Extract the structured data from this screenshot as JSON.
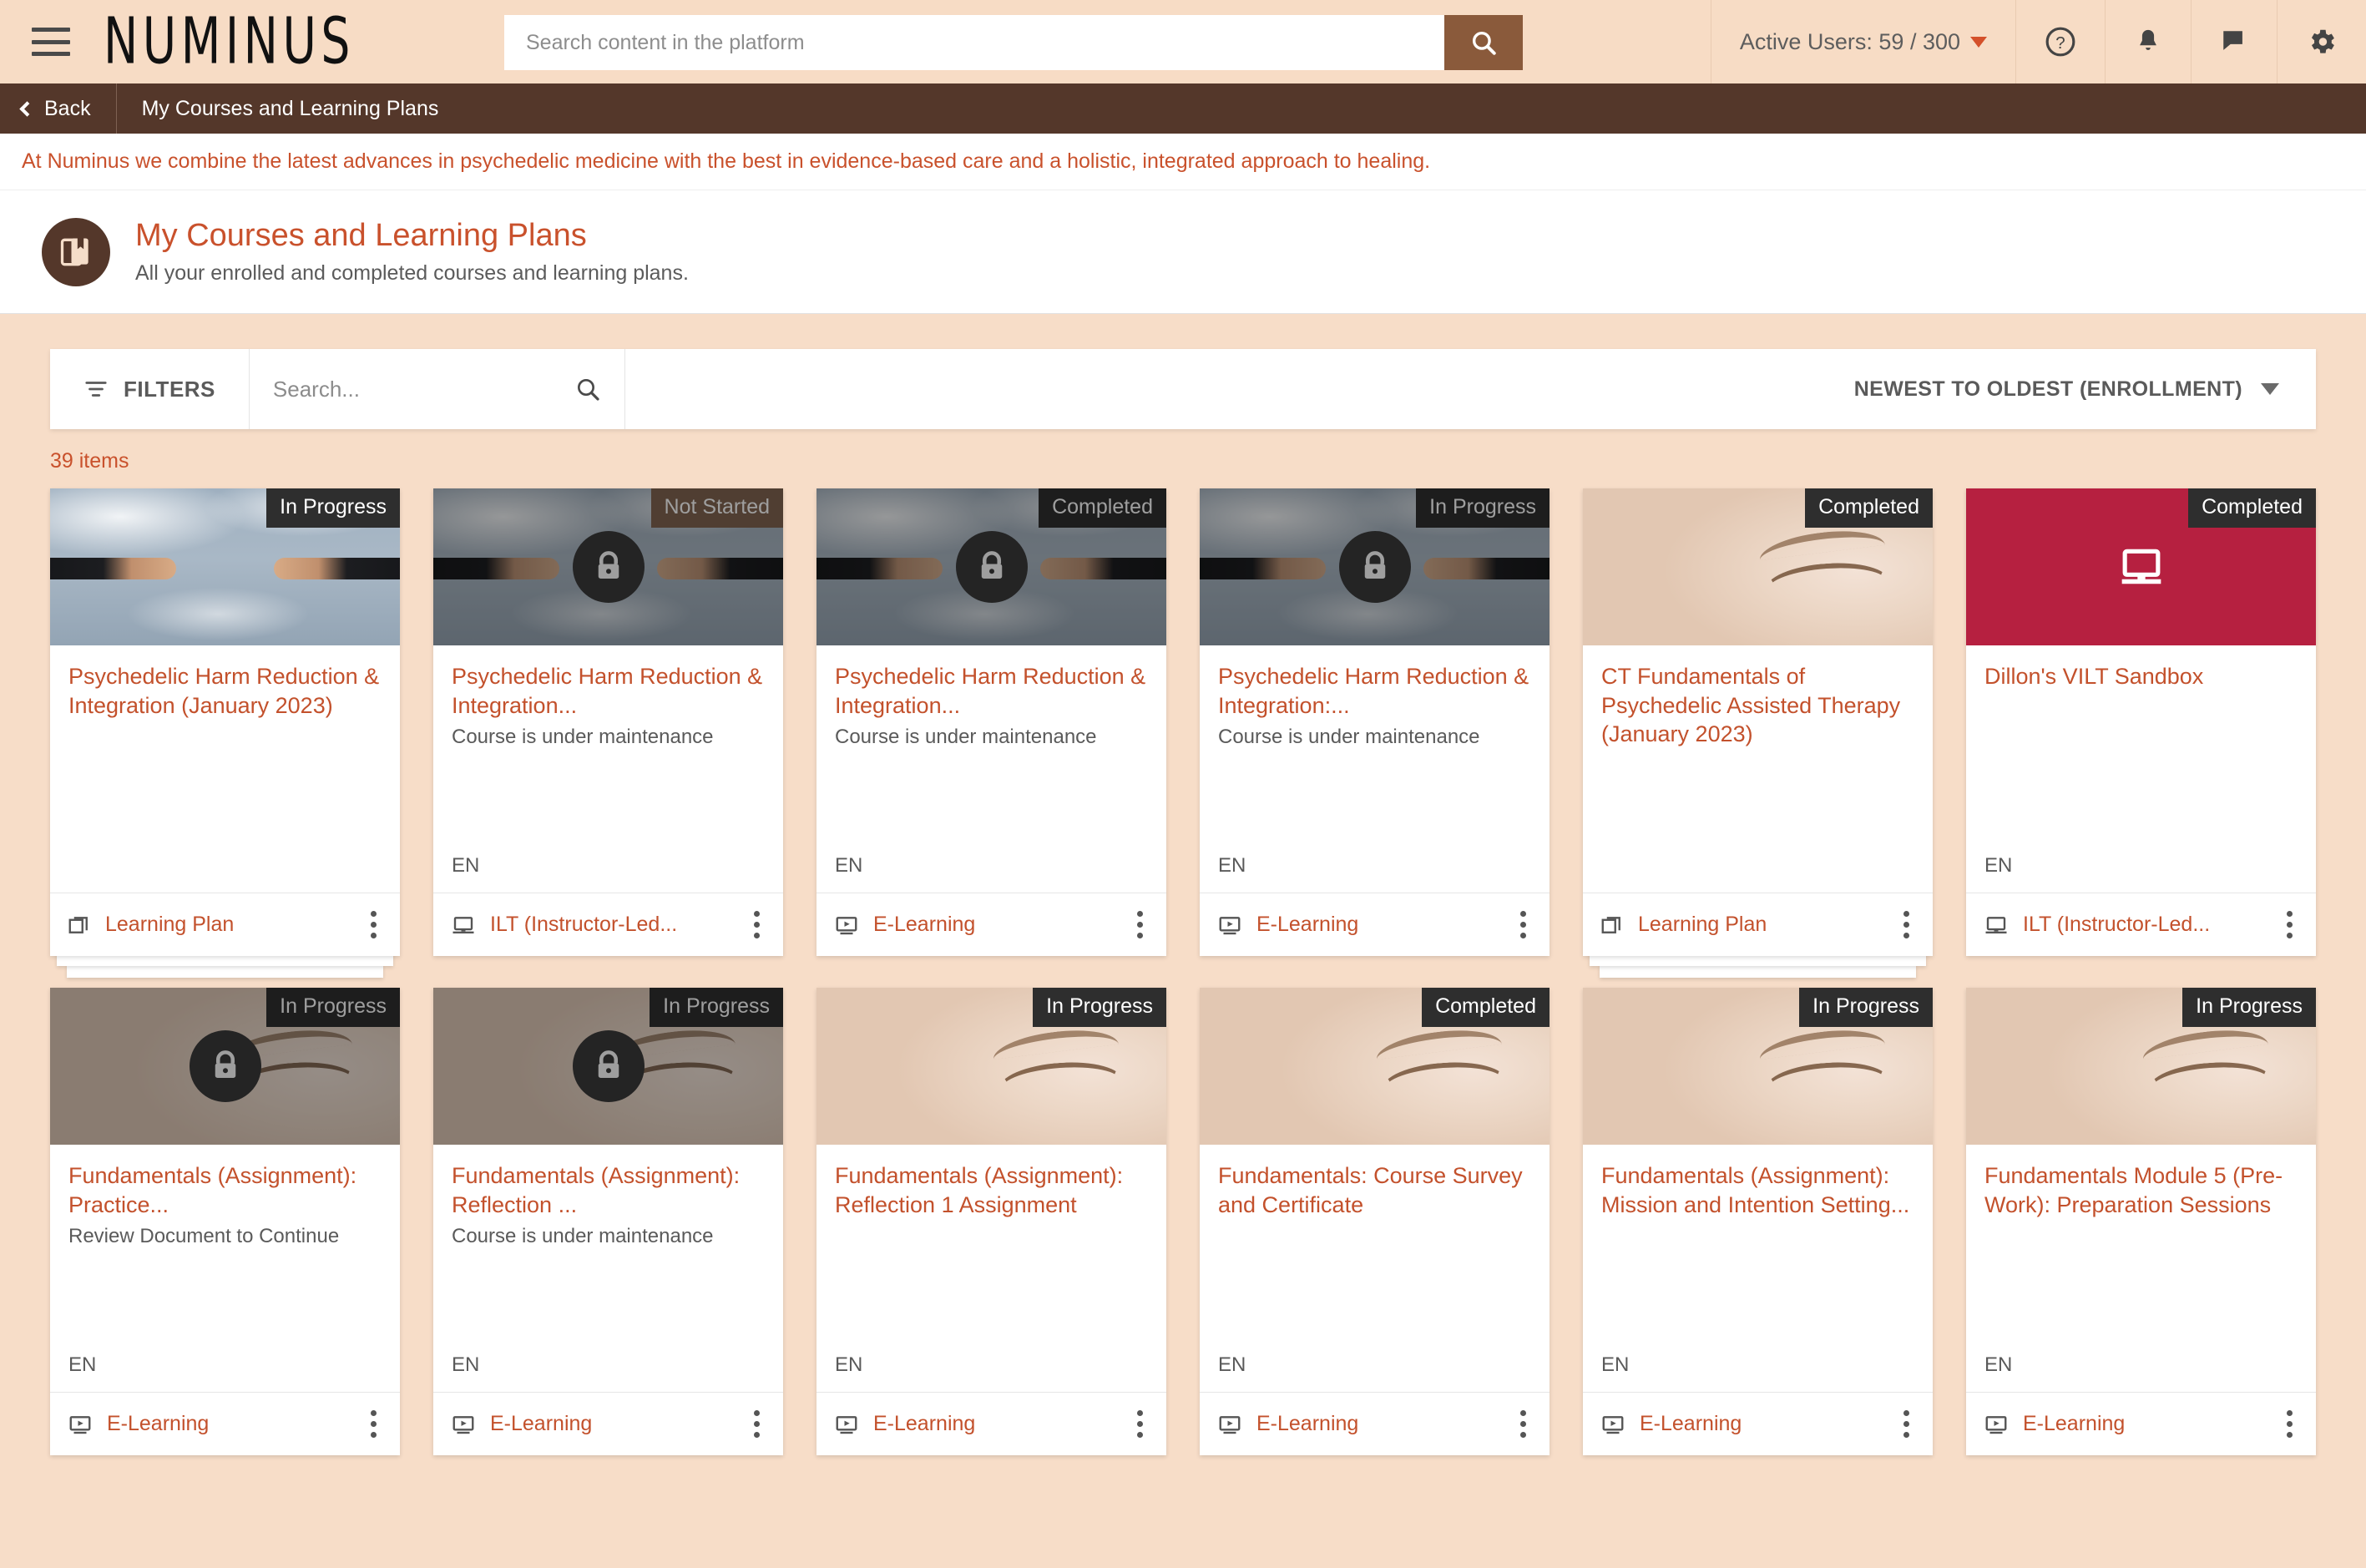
{
  "header": {
    "brand": "NUMINUS",
    "menu_icon": "hamburger-icon",
    "search_placeholder": "Search content in the platform",
    "search_value": "",
    "active_users": "Active Users: 59 / 300",
    "icons": [
      "help-icon",
      "bell-icon",
      "chat-icon",
      "gear-icon"
    ]
  },
  "breadcrumb": {
    "back_label": "Back",
    "title": "My Courses and Learning Plans"
  },
  "notice": {
    "text": "At Numinus we combine the latest advances in psychedelic medicine with the best in evidence-based care and a holistic, integrated approach to healing."
  },
  "page": {
    "title": "My Courses and Learning Plans",
    "subtitle": "All your enrolled and completed courses and learning plans."
  },
  "toolbar": {
    "filters_label": "FILTERS",
    "search_placeholder": "Search...",
    "search_value": "",
    "sort_label": "NEWEST TO OLDEST (ENROLLMENT)",
    "item_count": "39 items"
  },
  "colors": {
    "page_bg": "#f7ddc8",
    "brand_brown": "#54372a",
    "accent_orange": "#c3512c",
    "badge_dark": "#2e2e2e",
    "badge_brown": "#86634d",
    "tile_red": "#b62040"
  },
  "cards": [
    {
      "status": "In Progress",
      "status_style": "dark",
      "title": "Psychedelic Harm Reduction & Integration (January 2023)",
      "subtitle": "",
      "language": "",
      "type_label": "Learning Plan",
      "type_icon": "layers-icon",
      "thumb": "hands",
      "locked": false,
      "stacked": true
    },
    {
      "status": "Not Started",
      "status_style": "brown",
      "title": "Psychedelic Harm Reduction & Integration...",
      "subtitle": "Course is under maintenance",
      "language": "EN",
      "type_label": "ILT (Instructor-Led...",
      "type_icon": "classroom-icon",
      "thumb": "hands",
      "locked": true,
      "stacked": false
    },
    {
      "status": "Completed",
      "status_style": "dark",
      "title": "Psychedelic Harm Reduction & Integration...",
      "subtitle": "Course is under maintenance",
      "language": "EN",
      "type_label": "E-Learning",
      "type_icon": "elearning-icon",
      "thumb": "hands",
      "locked": true,
      "stacked": false
    },
    {
      "status": "In Progress",
      "status_style": "dark",
      "title": "Psychedelic Harm Reduction & Integration:...",
      "subtitle": "Course is under maintenance",
      "language": "EN",
      "type_label": "E-Learning",
      "type_icon": "elearning-icon",
      "thumb": "hands",
      "locked": true,
      "stacked": false
    },
    {
      "status": "Completed",
      "status_style": "dark",
      "title": "CT Fundamentals of Psychedelic Assisted Therapy (January 2023)",
      "subtitle": "",
      "language": "",
      "type_label": "Learning Plan",
      "type_icon": "layers-icon",
      "thumb": "face",
      "locked": false,
      "stacked": true
    },
    {
      "status": "Completed",
      "status_style": "dark",
      "title": "Dillon's VILT Sandbox",
      "subtitle": "",
      "language": "EN",
      "type_label": "ILT (Instructor-Led...",
      "type_icon": "classroom-icon",
      "thumb": "flat-red",
      "locked": false,
      "stacked": false
    },
    {
      "status": "In Progress",
      "status_style": "dark",
      "title": "Fundamentals (Assignment): Practice...",
      "subtitle": "Review Document to Continue",
      "language": "EN",
      "type_label": "E-Learning",
      "type_icon": "elearning-icon",
      "thumb": "face",
      "locked": true,
      "stacked": false
    },
    {
      "status": "In Progress",
      "status_style": "dark",
      "title": "Fundamentals (Assignment): Reflection ...",
      "subtitle": "Course is under maintenance",
      "language": "EN",
      "type_label": "E-Learning",
      "type_icon": "elearning-icon",
      "thumb": "face",
      "locked": true,
      "stacked": false
    },
    {
      "status": "In Progress",
      "status_style": "dark",
      "title": "Fundamentals (Assignment): Reflection 1 Assignment",
      "subtitle": "",
      "language": "EN",
      "type_label": "E-Learning",
      "type_icon": "elearning-icon",
      "thumb": "face",
      "locked": false,
      "stacked": false
    },
    {
      "status": "Completed",
      "status_style": "dark",
      "title": "Fundamentals: Course Survey and Certificate",
      "subtitle": "",
      "language": "EN",
      "type_label": "E-Learning",
      "type_icon": "elearning-icon",
      "thumb": "face",
      "locked": false,
      "stacked": false
    },
    {
      "status": "In Progress",
      "status_style": "dark",
      "title": "Fundamentals (Assignment): Mission and Intention Setting...",
      "subtitle": "",
      "language": "EN",
      "type_label": "E-Learning",
      "type_icon": "elearning-icon",
      "thumb": "face",
      "locked": false,
      "stacked": false
    },
    {
      "status": "In Progress",
      "status_style": "dark",
      "title": "Fundamentals Module 5 (Pre-Work): Preparation Sessions",
      "subtitle": "",
      "language": "EN",
      "type_label": "E-Learning",
      "type_icon": "elearning-icon",
      "thumb": "face",
      "locked": false,
      "stacked": false
    }
  ]
}
